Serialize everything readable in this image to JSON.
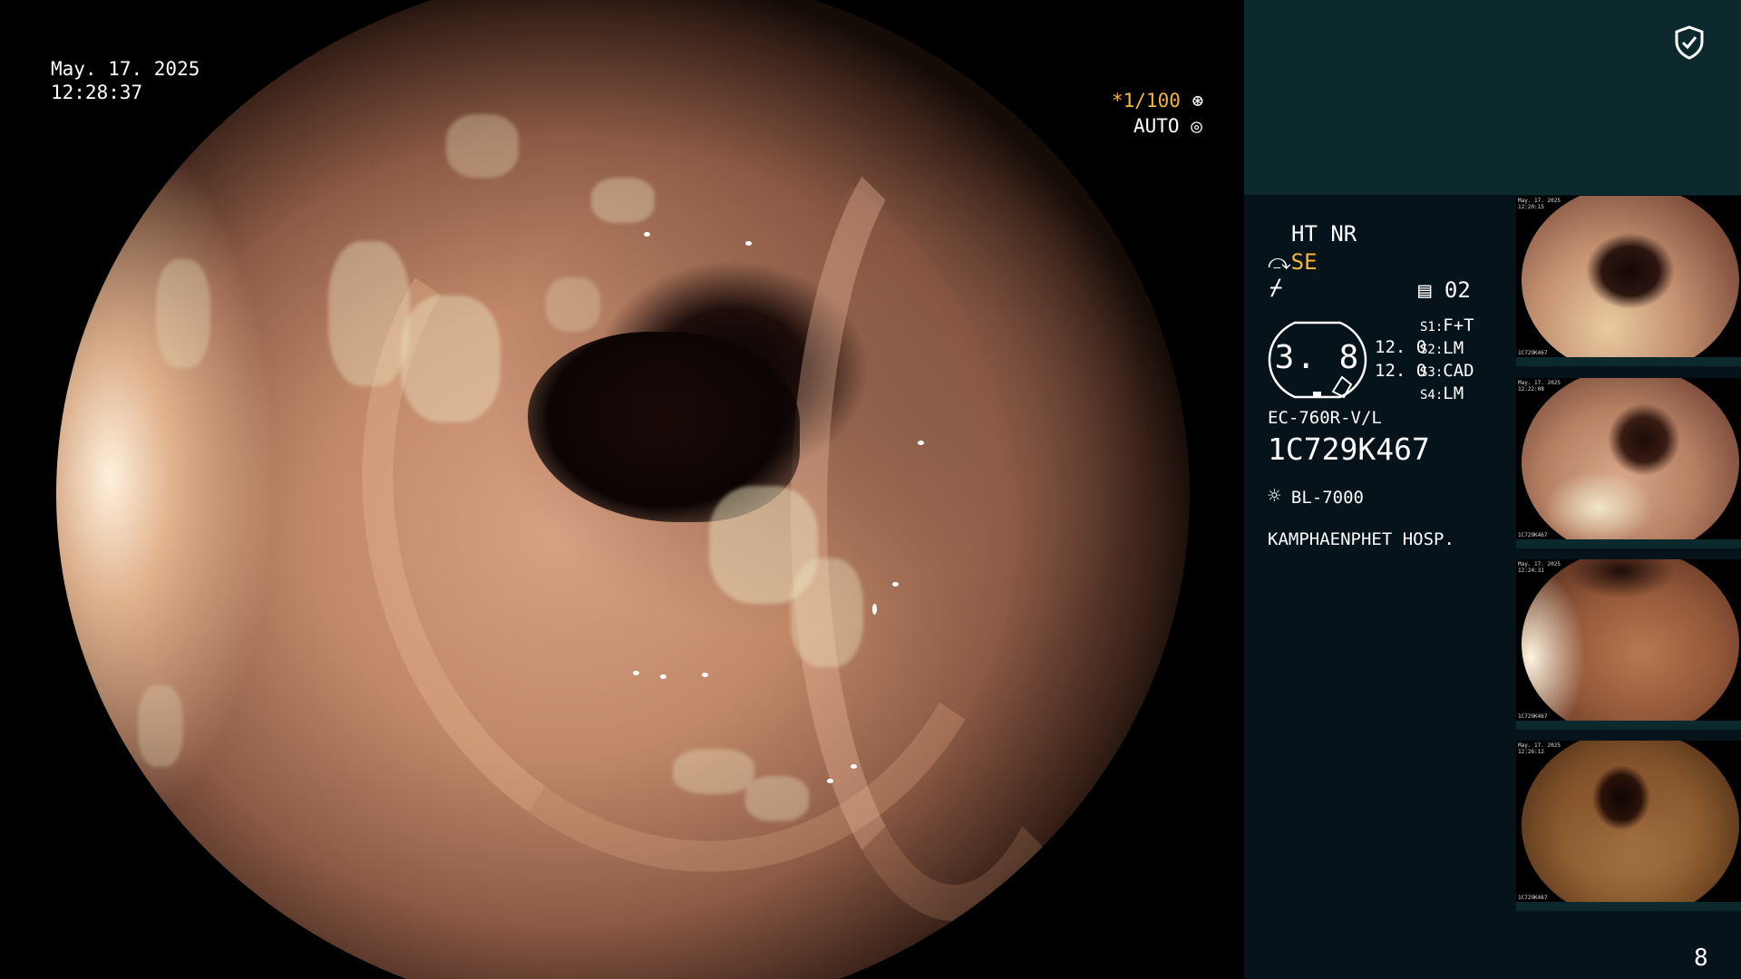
{
  "osd": {
    "date": "May. 17. 2025",
    "time": "12:28:37",
    "shutter": "*1/100",
    "exposure": "AUTO"
  },
  "panel": {
    "mode_line": "HT NR",
    "enhance": "SE",
    "channel": "02",
    "gauge_value": "3. 8",
    "value_a": "12. 0",
    "value_b": "12. 0",
    "settings": [
      {
        "key": "S1:",
        "value": "F+T"
      },
      {
        "key": "S2:",
        "value": "LM"
      },
      {
        "key": "S3:",
        "value": "CAD"
      },
      {
        "key": "S4:",
        "value": "LM"
      }
    ],
    "scope_model": "EC-760R-V/L",
    "scope_serial": "1C729K467",
    "light_source": "BL-7000",
    "hospital": "KAMPHAENPHET HOSP.",
    "image_count": "8"
  },
  "thumbnails": [
    {
      "date": "May. 17. 2025",
      "time": "12:20:15",
      "serial": "1C729K467"
    },
    {
      "date": "May. 17. 2025",
      "time": "12:22:08",
      "serial": "1C729K467"
    },
    {
      "date": "May. 17. 2025",
      "time": "12:24:31",
      "serial": "1C729K467"
    },
    {
      "date": "May. 17. 2025",
      "time": "12:26:12",
      "serial": "1C729K467"
    }
  ],
  "icons": {
    "shield": "shield-check-icon",
    "light": "sun-icon",
    "memory": "memory-card-icon",
    "enhance": "enhance-icon",
    "structure": "structure-icon"
  },
  "colors": {
    "accent": "#f4b63c",
    "panel_top": "#0c2a2d",
    "panel_bg": "#07131a"
  }
}
